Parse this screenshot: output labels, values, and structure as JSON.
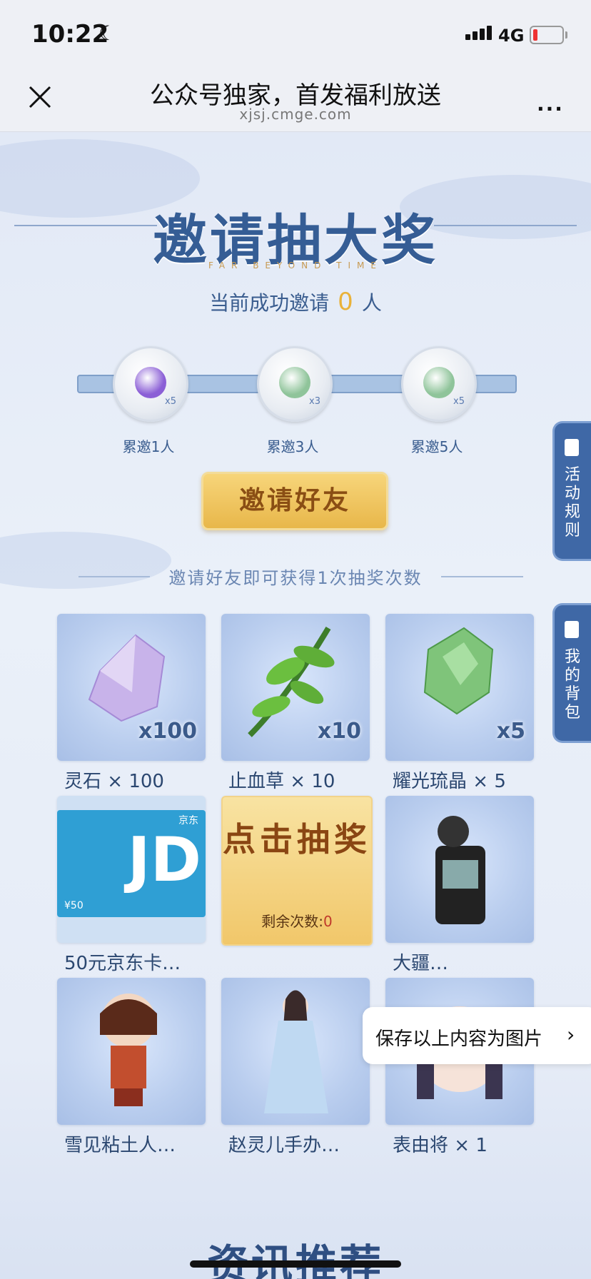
{
  "status": {
    "time": "10:22",
    "network": "4G"
  },
  "nav": {
    "title": "公众号独家，首发福利放送",
    "domain": "xjsj.cmge.com",
    "more": "···"
  },
  "header": {
    "title": "邀请抽大奖",
    "subtitle_en": "FAR BEYOND TIME",
    "invite_prefix": "当前成功邀请",
    "invite_count": "0",
    "invite_suffix": "人"
  },
  "milestones": [
    {
      "label": "累邀1人",
      "qty": "x5",
      "color": "#8b5fd6"
    },
    {
      "label": "累邀3人",
      "qty": "x3",
      "color": "#8fc49a"
    },
    {
      "label": "累邀5人",
      "qty": "x5",
      "color": "#8fc49a"
    }
  ],
  "invite_button": "邀请好友",
  "hint": "邀请好友即可获得1次抽奖次数",
  "side_tabs": {
    "rules": "活动规则",
    "bag": "我的背包"
  },
  "prizes": [
    {
      "name": "灵石 × 100",
      "qty": "x100"
    },
    {
      "name": "止血草 × 10",
      "qty": "x10"
    },
    {
      "name": "耀光琉晶 × 5",
      "qty": "x5"
    },
    {
      "name": "50元京东卡…",
      "qty": "",
      "jd_price": "¥50",
      "jd_logo": "JD",
      "jd_brand": "京东"
    },
    {
      "name": "",
      "qty": ""
    },
    {
      "name": "大疆…",
      "qty": ""
    },
    {
      "name": "雪见粘土人…",
      "qty": ""
    },
    {
      "name": "赵灵儿手办…",
      "qty": ""
    },
    {
      "name": "表由将 × 1",
      "qty": ""
    }
  ],
  "draw": {
    "title": "点击抽奖",
    "remaining_label": "剩余次数:",
    "remaining": "0"
  },
  "save_popup": {
    "text": "保存以上内容为图片",
    "chevron": "›"
  },
  "bottom_title": "资讯推荐"
}
